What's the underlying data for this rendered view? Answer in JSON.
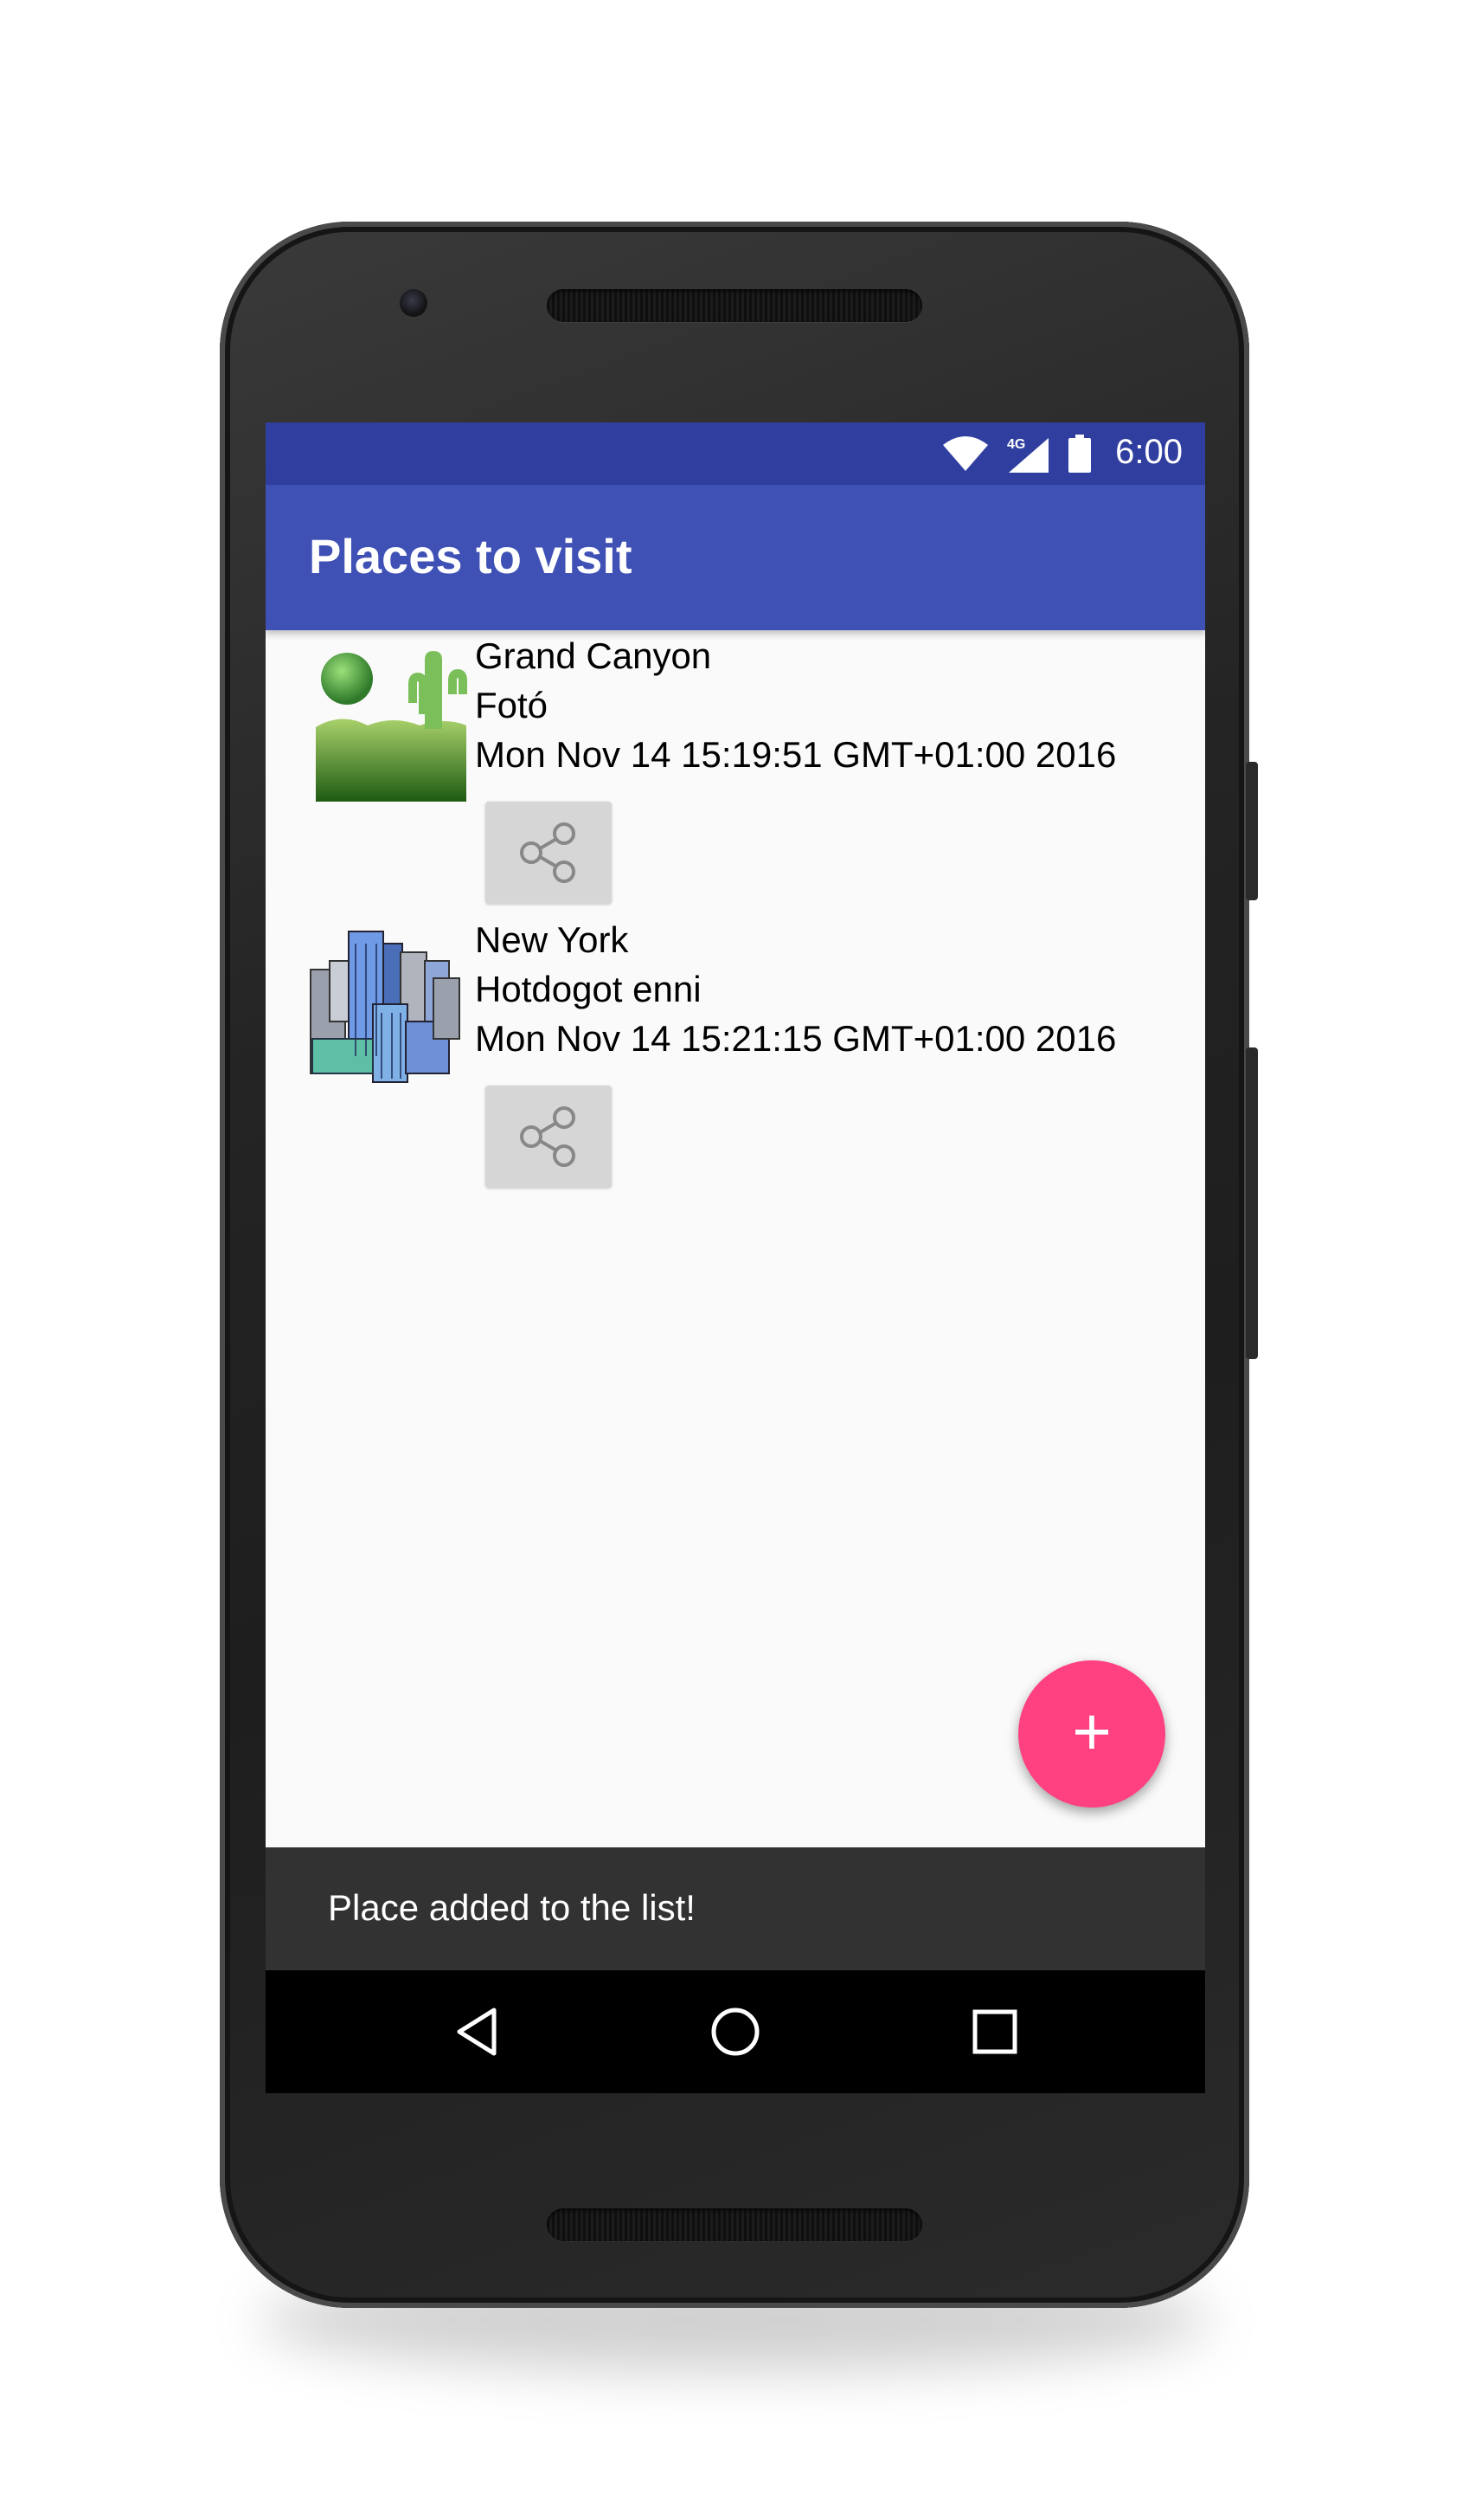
{
  "status_bar": {
    "time": "6:00",
    "network": "4G",
    "icons": [
      "wifi-icon",
      "signal-icon",
      "battery-icon"
    ]
  },
  "app_bar": {
    "title": "Places to visit"
  },
  "places": [
    {
      "name": "Grand Canyon",
      "description": "Fotó",
      "date": "Mon Nov 14 15:19:51 GMT+01:00 2016",
      "icon": "desert-landscape-icon",
      "share_icon": "share-icon"
    },
    {
      "name": "New York",
      "description": "Hotdogot enni",
      "date": "Mon Nov 14 15:21:15 GMT+01:00 2016",
      "icon": "city-buildings-icon",
      "share_icon": "share-icon"
    }
  ],
  "fab": {
    "label": "+",
    "icon": "add-icon"
  },
  "snackbar": {
    "message": "Place added to the list!"
  },
  "nav_bar": {
    "buttons": [
      "back-icon",
      "home-icon",
      "recents-icon"
    ]
  },
  "colors": {
    "primary": "#3f51b5",
    "primary_dark": "#303f9f",
    "accent": "#ff4081",
    "snackbar": "#323232"
  }
}
